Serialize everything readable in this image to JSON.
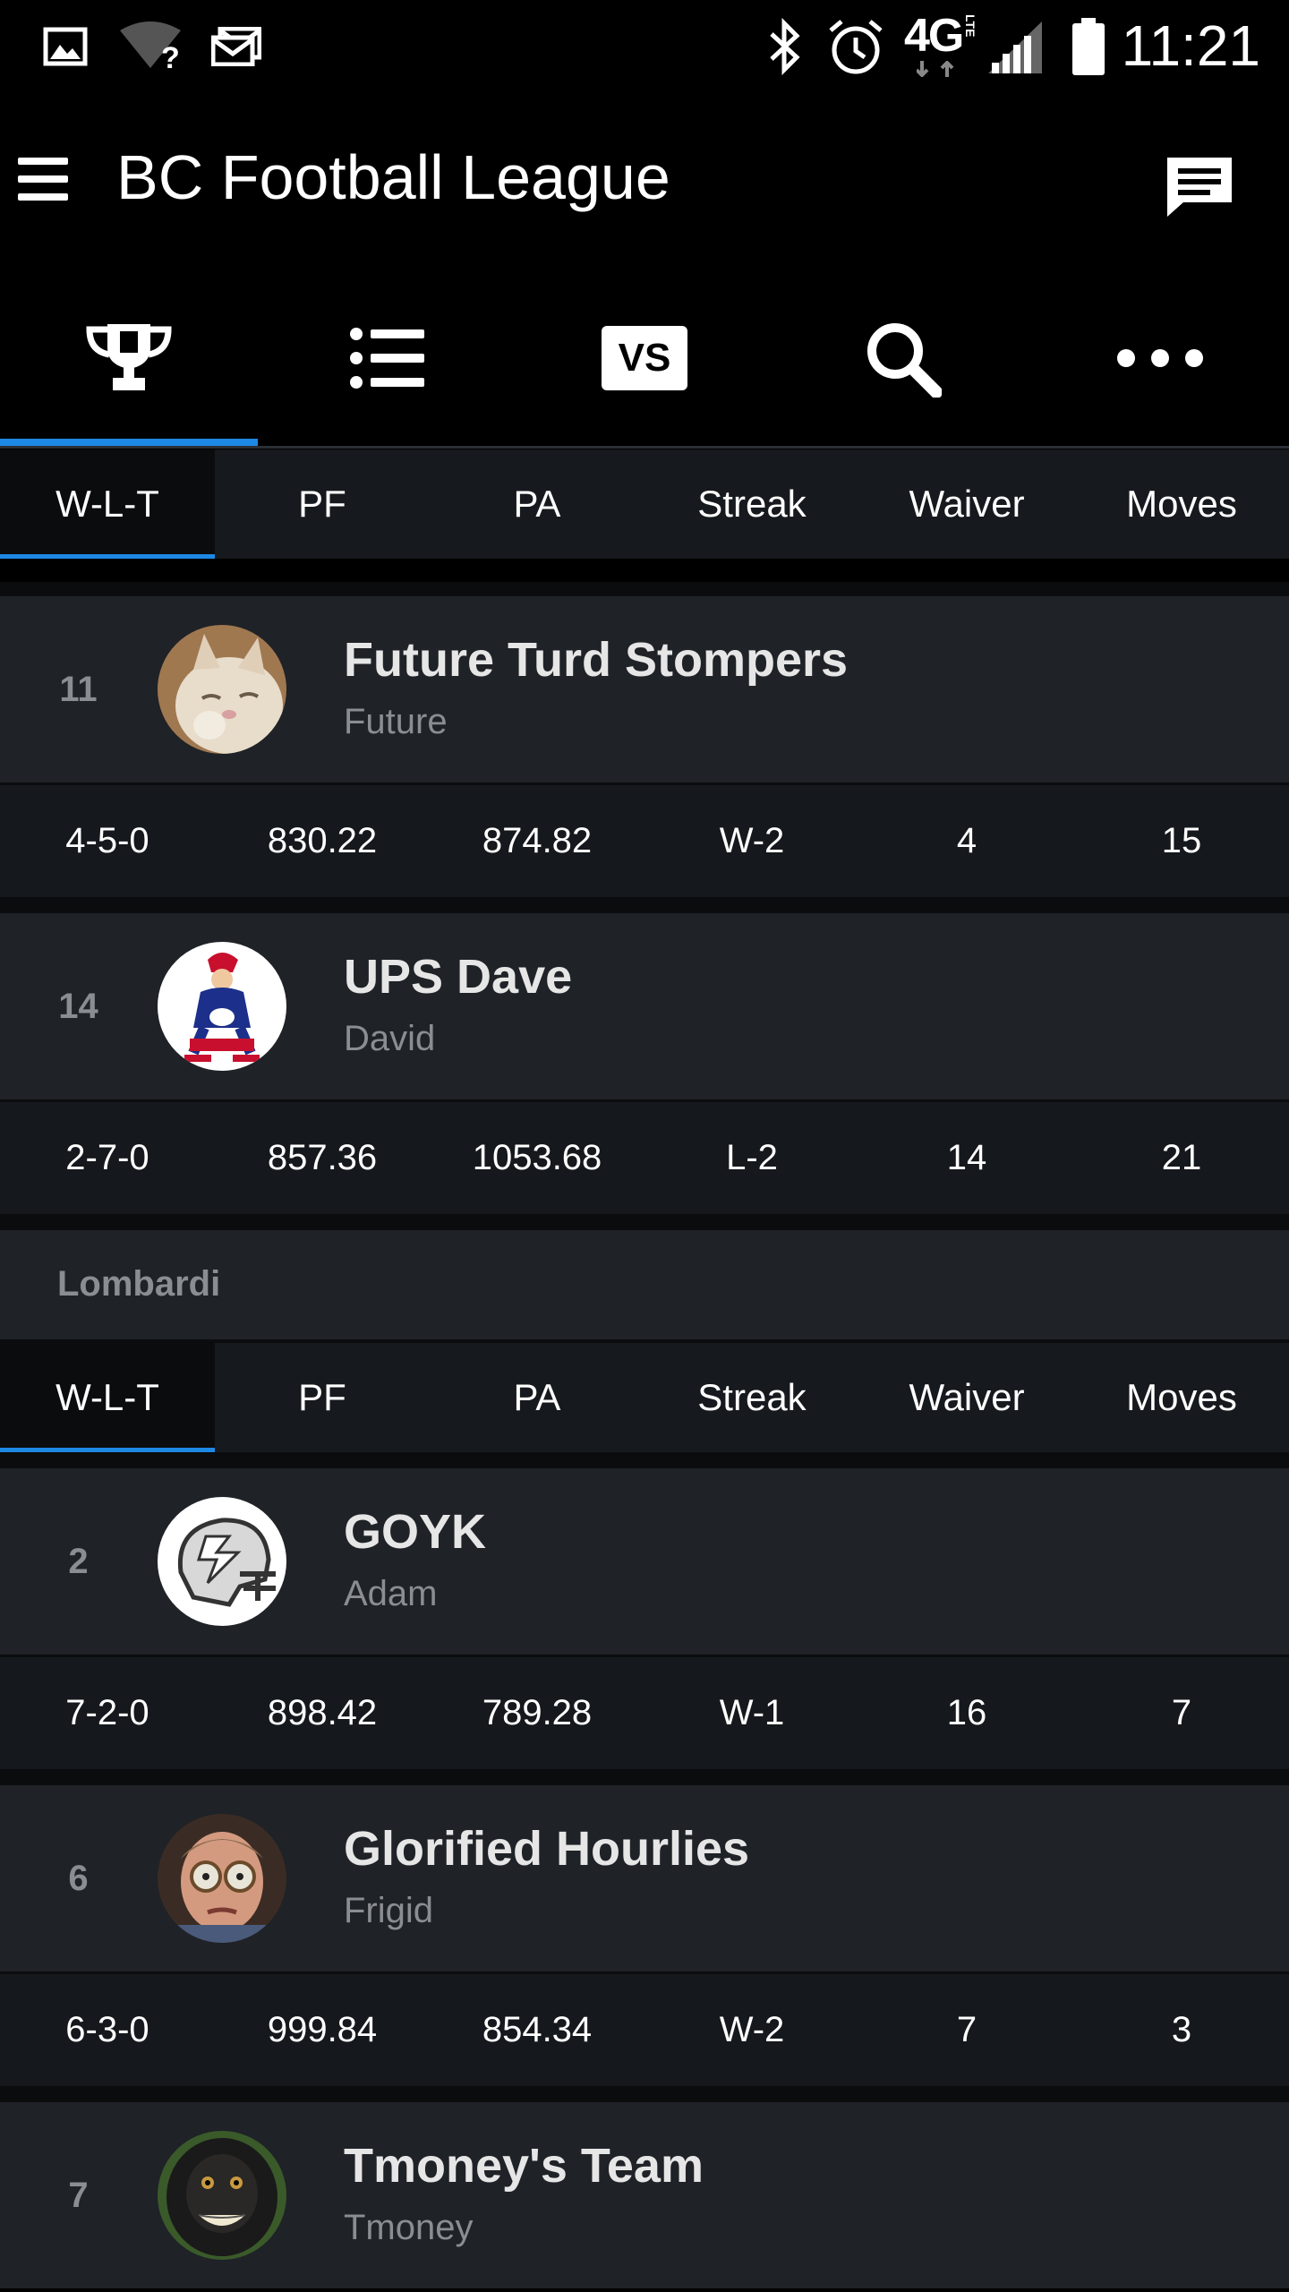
{
  "status_bar": {
    "time": "11:21",
    "network_label": "4G",
    "lte_label": "LTE",
    "icons": [
      "image-icon",
      "wifi-unknown-icon",
      "mail-icon",
      "bluetooth-icon",
      "alarm-icon",
      "network-4g-lte-icon",
      "signal-icon",
      "battery-icon"
    ]
  },
  "app_bar": {
    "title": "BC Football League",
    "menu_icon": "hamburger-menu-icon",
    "chat_icon": "chat-icon"
  },
  "main_tabs": [
    {
      "icon": "trophy-icon",
      "active": true
    },
    {
      "icon": "list-icon",
      "active": false
    },
    {
      "icon": "vs-icon",
      "label": "VS",
      "active": false
    },
    {
      "icon": "search-icon",
      "active": false
    },
    {
      "icon": "more-icon",
      "active": false
    }
  ],
  "sub_tabs": [
    "W-L-T",
    "PF",
    "PA",
    "Streak",
    "Waiver",
    "Moves"
  ],
  "teams_top": [
    {
      "rank": "11",
      "name": "Future Turd Stompers",
      "owner": "Future",
      "stats": [
        "4-5-0",
        "830.22",
        "874.82",
        "W-2",
        "4",
        "15"
      ]
    },
    {
      "rank": "14",
      "name": "UPS Dave",
      "owner": "David",
      "stats": [
        "2-7-0",
        "857.36",
        "1053.68",
        "L-2",
        "14",
        "21"
      ]
    }
  ],
  "division": {
    "name": "Lombardi",
    "teams": [
      {
        "rank": "2",
        "name": "GOYK",
        "owner": "Adam",
        "stats": [
          "7-2-0",
          "898.42",
          "789.28",
          "W-1",
          "16",
          "7"
        ]
      },
      {
        "rank": "6",
        "name": "Glorified Hourlies",
        "owner": "Frigid",
        "stats": [
          "6-3-0",
          "999.84",
          "854.34",
          "W-2",
          "7",
          "3"
        ]
      },
      {
        "rank": "7",
        "name": "Tmoney's Team",
        "owner": "Tmoney"
      }
    ]
  },
  "colors": {
    "accent": "#1e88e5",
    "background": "#0b0c0e",
    "card": "#1f2227",
    "stats_row": "#15181c",
    "muted_text": "#8a8d92"
  }
}
